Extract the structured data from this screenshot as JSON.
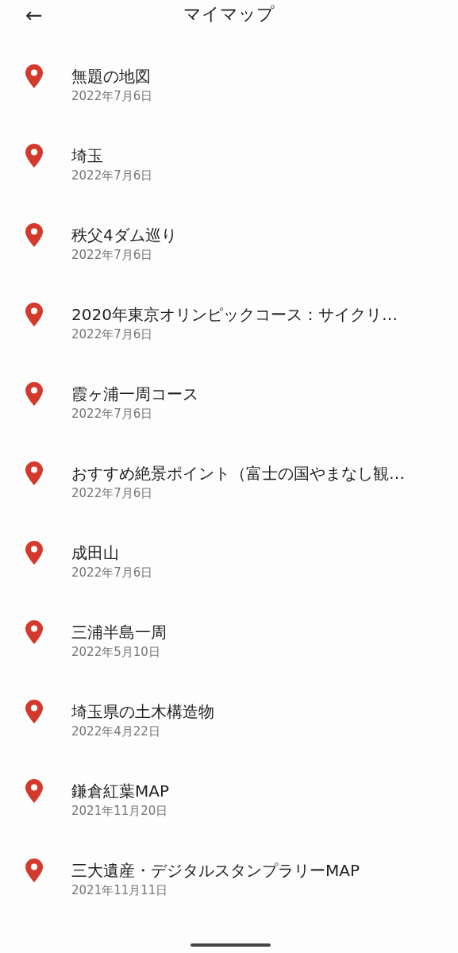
{
  "header": {
    "back": "←",
    "title": "マイマップ"
  },
  "maps": [
    {
      "title": "無題の地図",
      "date": "2022年7月6日"
    },
    {
      "title": "埼玉",
      "date": "2022年7月6日"
    },
    {
      "title": "秩父4ダム巡り",
      "date": "2022年7月6日"
    },
    {
      "title": "2020年東京オリンピックコース：サイクリ…",
      "date": "2022年7月6日"
    },
    {
      "title": "霞ヶ浦一周コース",
      "date": "2022年7月6日"
    },
    {
      "title": "おすすめ絶景ポイント（富士の国やまなし観…",
      "date": "2022年7月6日"
    },
    {
      "title": "成田山",
      "date": "2022年7月6日"
    },
    {
      "title": "三浦半島一周",
      "date": "2022年5月10日"
    },
    {
      "title": "埼玉県の土木構造物",
      "date": "2022年4月22日"
    },
    {
      "title": "鎌倉紅葉MAP",
      "date": "2021年11月20日"
    },
    {
      "title": "三大遺産・デジタルスタンプラリーMAP",
      "date": "2021年11月11日"
    }
  ]
}
